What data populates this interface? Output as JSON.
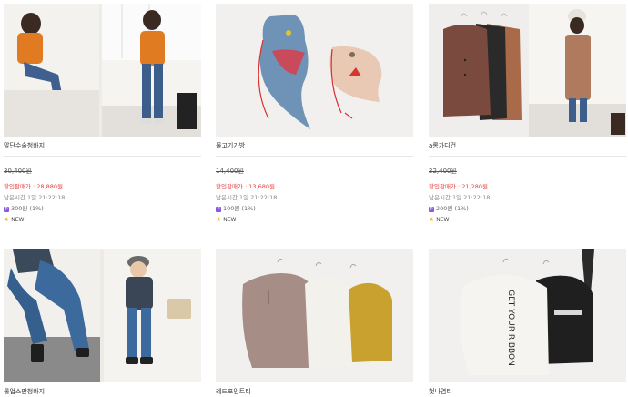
{
  "products": [
    {
      "name": "말단수술청바지",
      "original_price": "30,400원",
      "sale_label": "할인판매가",
      "sale_price": "28,880원",
      "time_label": "남은시간",
      "remaining_time": "1일 21:22:18",
      "points": "300원 (1%)",
      "badge": "NEW"
    },
    {
      "name": "물고기가방",
      "original_price": "14,400원",
      "sale_label": "할인판매가",
      "sale_price": "13,680원",
      "time_label": "남은시간",
      "remaining_time": "1일 21:22:18",
      "points": "100원 (1%)",
      "badge": "NEW"
    },
    {
      "name": "a롱가디건",
      "original_price": "22,400원",
      "sale_label": "할인판매가",
      "sale_price": "21,280원",
      "time_label": "남은시간",
      "remaining_time": "1일 21:22:18",
      "points": "200원 (1%)",
      "badge": "NEW"
    },
    {
      "name": "롤업스판청바지"
    },
    {
      "name": "레드포인트티"
    },
    {
      "name": "헛나염티"
    }
  ],
  "colors": {
    "sale": "#e83e3e",
    "point_badge": "#8a5bd8",
    "star": "#f0b400"
  },
  "icons": [
    "point-icon",
    "star-icon"
  ]
}
